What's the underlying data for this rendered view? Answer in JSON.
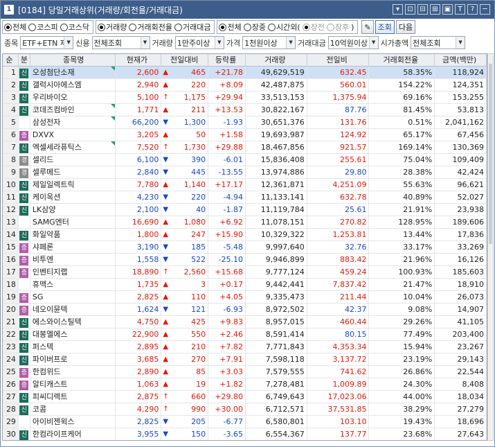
{
  "titlebar": {
    "num": "1",
    "title": "[0184] 당일거래상위(거래량/회전율/거래대금)",
    "icons": [
      "▾",
      "⊡",
      "⊟",
      "⊞",
      "▣",
      "T",
      "?",
      "─"
    ]
  },
  "market_group": {
    "opts": [
      "전체",
      "코스피",
      "코스닥"
    ],
    "selected": 0
  },
  "sort_group": {
    "opts": [
      "거래량",
      "거래회전율",
      "거래대금"
    ],
    "selected": 0
  },
  "time_group": {
    "opts": [
      "전체",
      "장중",
      "시간외(",
      "장전",
      "장후",
      ")"
    ],
    "selected": 0
  },
  "buttons": {
    "pin": "✎",
    "query": "조회",
    "next": "다음"
  },
  "filters": {
    "item_label": "종목",
    "item_value": "ETF+ETN 제",
    "credit_label": "신용",
    "credit_value": "전체조회",
    "volume_label": "거래량",
    "volume_value": "1만주이상",
    "price_label": "가격",
    "price_value": "1천원이상",
    "amount_label": "거래대금",
    "amount_value": "10억원이상",
    "mcap_label": "시가총액",
    "mcap_value": "전체조회"
  },
  "table": {
    "headers": [
      "순위",
      "분",
      "종목명",
      "현재가",
      "전일대비",
      "등락률",
      "거래량",
      "전일비",
      "거래회전율",
      "금액(백만)"
    ],
    "rows": [
      {
        "rank": "1",
        "badge": "신",
        "name": "오성첨단소재",
        "price": "2,600",
        "dir": "up",
        "chg": "465",
        "rate": "+21.78",
        "vol": "49,629,519",
        "prev": "632.45",
        "turn": "58.35%",
        "amt": "118,924",
        "mark": true
      },
      {
        "rank": "2",
        "badge": "신",
        "name": "갤럭시아에스엠",
        "price": "2,940",
        "dir": "up",
        "chg": "220",
        "rate": "+8.09",
        "vol": "42,487,875",
        "prev": "560.01",
        "turn": "154.22%",
        "amt": "124,351",
        "mark": false
      },
      {
        "rank": "3",
        "badge": "신",
        "name": "우리바이오",
        "price": "5,100",
        "dir": "upbig",
        "chg": "1,175",
        "rate": "+29.94",
        "vol": "33,513,153",
        "prev": "1,375.94",
        "turn": "69.16%",
        "amt": "153,255",
        "mark": false
      },
      {
        "rank": "4",
        "badge": "신",
        "name": "코데즈컴바인",
        "price": "1,771",
        "dir": "up",
        "chg": "211",
        "rate": "+13.53",
        "vol": "30,822,167",
        "prev": "87.76",
        "turn": "81.45%",
        "amt": "53,813",
        "mark": true
      },
      {
        "rank": "5",
        "badge": "",
        "name": "삼성전자",
        "price": "66,200",
        "dir": "dn",
        "chg": "1,300",
        "rate": "-1.93",
        "vol": "30,651,376",
        "prev": "131.76",
        "turn": "0.51%",
        "amt": "2,041,162",
        "mark": true
      },
      {
        "rank": "6",
        "badge": "증",
        "name": "DXVX",
        "price": "3,205",
        "dir": "up",
        "chg": "50",
        "rate": "+1.58",
        "vol": "19,693,987",
        "prev": "124.92",
        "turn": "65.17%",
        "amt": "67,456",
        "mark": false
      },
      {
        "rank": "7",
        "badge": "신",
        "name": "엑셀세라퓨틱스",
        "price": "7,520",
        "dir": "upbig",
        "chg": "1,730",
        "rate": "+29.88",
        "vol": "18,467,856",
        "prev": "921.57",
        "turn": "169.14%",
        "amt": "130,369",
        "mark": true
      },
      {
        "rank": "8",
        "badge": "경",
        "name": "셀리드",
        "price": "6,100",
        "dir": "dn",
        "chg": "390",
        "rate": "-6.01",
        "vol": "15,836,408",
        "prev": "255.61",
        "turn": "75.04%",
        "amt": "109,409",
        "mark": false
      },
      {
        "rank": "9",
        "badge": "경",
        "name": "셀루메드",
        "price": "2,840",
        "dir": "dn",
        "chg": "445",
        "rate": "-13.55",
        "vol": "13,974,886",
        "prev": "29.80",
        "turn": "28.38%",
        "amt": "42,424",
        "mark": false
      },
      {
        "rank": "10",
        "badge": "신",
        "name": "제일일렉트릭",
        "price": "7,780",
        "dir": "up",
        "chg": "1,140",
        "rate": "+17.17",
        "vol": "12,361,871",
        "prev": "4,251.09",
        "turn": "55.63%",
        "amt": "96,621",
        "mark": false
      },
      {
        "rank": "11",
        "badge": "신",
        "name": "케이옥션",
        "price": "4,230",
        "dir": "dn",
        "chg": "220",
        "rate": "-4.94",
        "vol": "11,133,141",
        "prev": "632.78",
        "turn": "40.89%",
        "amt": "52,027",
        "mark": false
      },
      {
        "rank": "12",
        "badge": "신",
        "name": "LK삼양",
        "price": "2,100",
        "dir": "dn",
        "chg": "40",
        "rate": "-1.87",
        "vol": "11,119,784",
        "prev": "25.61",
        "turn": "21.91%",
        "amt": "23,938",
        "mark": false
      },
      {
        "rank": "13",
        "badge": "",
        "name": "SAMG엔터",
        "price": "16,690",
        "dir": "up",
        "chg": "1,080",
        "rate": "+6.92",
        "vol": "11,078,151",
        "prev": "270.82",
        "turn": "128.95%",
        "amt": "189,606",
        "mark": false
      },
      {
        "rank": "14",
        "badge": "신",
        "name": "화일약품",
        "price": "1,800",
        "dir": "up",
        "chg": "247",
        "rate": "+15.90",
        "vol": "10,329,322",
        "prev": "1,253.81",
        "turn": "13.44%",
        "amt": "17,836",
        "mark": false
      },
      {
        "rank": "15",
        "badge": "증",
        "name": "샤페론",
        "price": "3,190",
        "dir": "dn",
        "chg": "185",
        "rate": "-5.48",
        "vol": "9,997,640",
        "prev": "32.76",
        "turn": "33.17%",
        "amt": "33,269",
        "mark": false
      },
      {
        "rank": "16",
        "badge": "증",
        "name": "비투엔",
        "price": "1,558",
        "dir": "dn",
        "chg": "522",
        "rate": "-25.10",
        "vol": "9,946,899",
        "prev": "883.42",
        "turn": "21.96%",
        "amt": "16,126",
        "mark": false
      },
      {
        "rank": "17",
        "badge": "증",
        "name": "인벤티지랩",
        "price": "18,890",
        "dir": "upbig",
        "chg": "2,560",
        "rate": "+15.68",
        "vol": "9,777,124",
        "prev": "459.24",
        "turn": "100.93%",
        "amt": "185,603",
        "mark": false
      },
      {
        "rank": "18",
        "badge": "",
        "name": "휴맥스",
        "price": "1,735",
        "dir": "up",
        "chg": "3",
        "rate": "+0.17",
        "vol": "9,442,441",
        "prev": "7,837.42",
        "turn": "21.47%",
        "amt": "18,910",
        "mark": false
      },
      {
        "rank": "19",
        "badge": "증",
        "name": "SG",
        "price": "2,825",
        "dir": "up",
        "chg": "110",
        "rate": "+4.05",
        "vol": "9,335,473",
        "prev": "211.44",
        "turn": "10.04%",
        "amt": "26,073",
        "mark": false
      },
      {
        "rank": "20",
        "badge": "증",
        "name": "네오이뮨텍",
        "price": "1,624",
        "dir": "dn",
        "chg": "121",
        "rate": "-6.93",
        "vol": "8,972,502",
        "prev": "42.37",
        "turn": "9.08%",
        "amt": "14,907",
        "mark": false
      },
      {
        "rank": "21",
        "badge": "신",
        "name": "에스와이스틸텍",
        "price": "4,750",
        "dir": "up",
        "chg": "425",
        "rate": "+9.83",
        "vol": "8,957,015",
        "prev": "460.44",
        "turn": "29.26%",
        "amt": "41,105",
        "mark": false
      },
      {
        "rank": "22",
        "badge": "신",
        "name": "대봉엘에스",
        "price": "22,900",
        "dir": "up",
        "chg": "550",
        "rate": "+2.46",
        "vol": "8,591,414",
        "prev": "80.15",
        "turn": "77.49%",
        "amt": "203,400",
        "mark": false
      },
      {
        "rank": "23",
        "badge": "신",
        "name": "퍼스텍",
        "price": "2,895",
        "dir": "up",
        "chg": "210",
        "rate": "+7.82",
        "vol": "7,771,843",
        "prev": "4,353.34",
        "turn": "15.94%",
        "amt": "23,267",
        "mark": false
      },
      {
        "rank": "24",
        "badge": "신",
        "name": "파이버프로",
        "price": "3,685",
        "dir": "up",
        "chg": "270",
        "rate": "+7.91",
        "vol": "7,598,118",
        "prev": "3,137.72",
        "turn": "23.19%",
        "amt": "29,143",
        "mark": false
      },
      {
        "rank": "25",
        "badge": "증",
        "name": "한컴위드",
        "price": "2,890",
        "dir": "up",
        "chg": "85",
        "rate": "+3.03",
        "vol": "7,579,555",
        "prev": "741.62",
        "turn": "26.86%",
        "amt": "22,544",
        "mark": false
      },
      {
        "rank": "26",
        "badge": "증",
        "name": "알티캐스트",
        "price": "1,063",
        "dir": "up",
        "chg": "19",
        "rate": "+1.82",
        "vol": "7,278,481",
        "prev": "1,009.89",
        "turn": "24.30%",
        "amt": "8,408",
        "mark": false
      },
      {
        "rank": "27",
        "badge": "신",
        "name": "피씨디렉트",
        "price": "2,875",
        "dir": "upbig",
        "chg": "660",
        "rate": "+29.80",
        "vol": "6,749,643",
        "prev": "17,023.06",
        "turn": "44.00%",
        "amt": "18,034",
        "mark": false
      },
      {
        "rank": "28",
        "badge": "신",
        "name": "코콤",
        "price": "4,290",
        "dir": "upbig",
        "chg": "990",
        "rate": "+30.00",
        "vol": "6,712,571",
        "prev": "37,531.85",
        "turn": "38.29%",
        "amt": "27,279",
        "mark": false
      },
      {
        "rank": "29",
        "badge": "",
        "name": "아이비젠윅스",
        "price": "2,825",
        "dir": "dn",
        "chg": "205",
        "rate": "-6.77",
        "vol": "6,580,801",
        "prev": "103.10",
        "turn": "19.43%",
        "amt": "18,696",
        "mark": false
      },
      {
        "rank": "30",
        "badge": "신",
        "name": "한컴라이프케어",
        "price": "3,955",
        "dir": "dn",
        "chg": "150",
        "rate": "-3.65",
        "vol": "6,554,367",
        "prev": "137.77",
        "turn": "23.68%",
        "amt": "27,643",
        "mark": false
      }
    ]
  }
}
